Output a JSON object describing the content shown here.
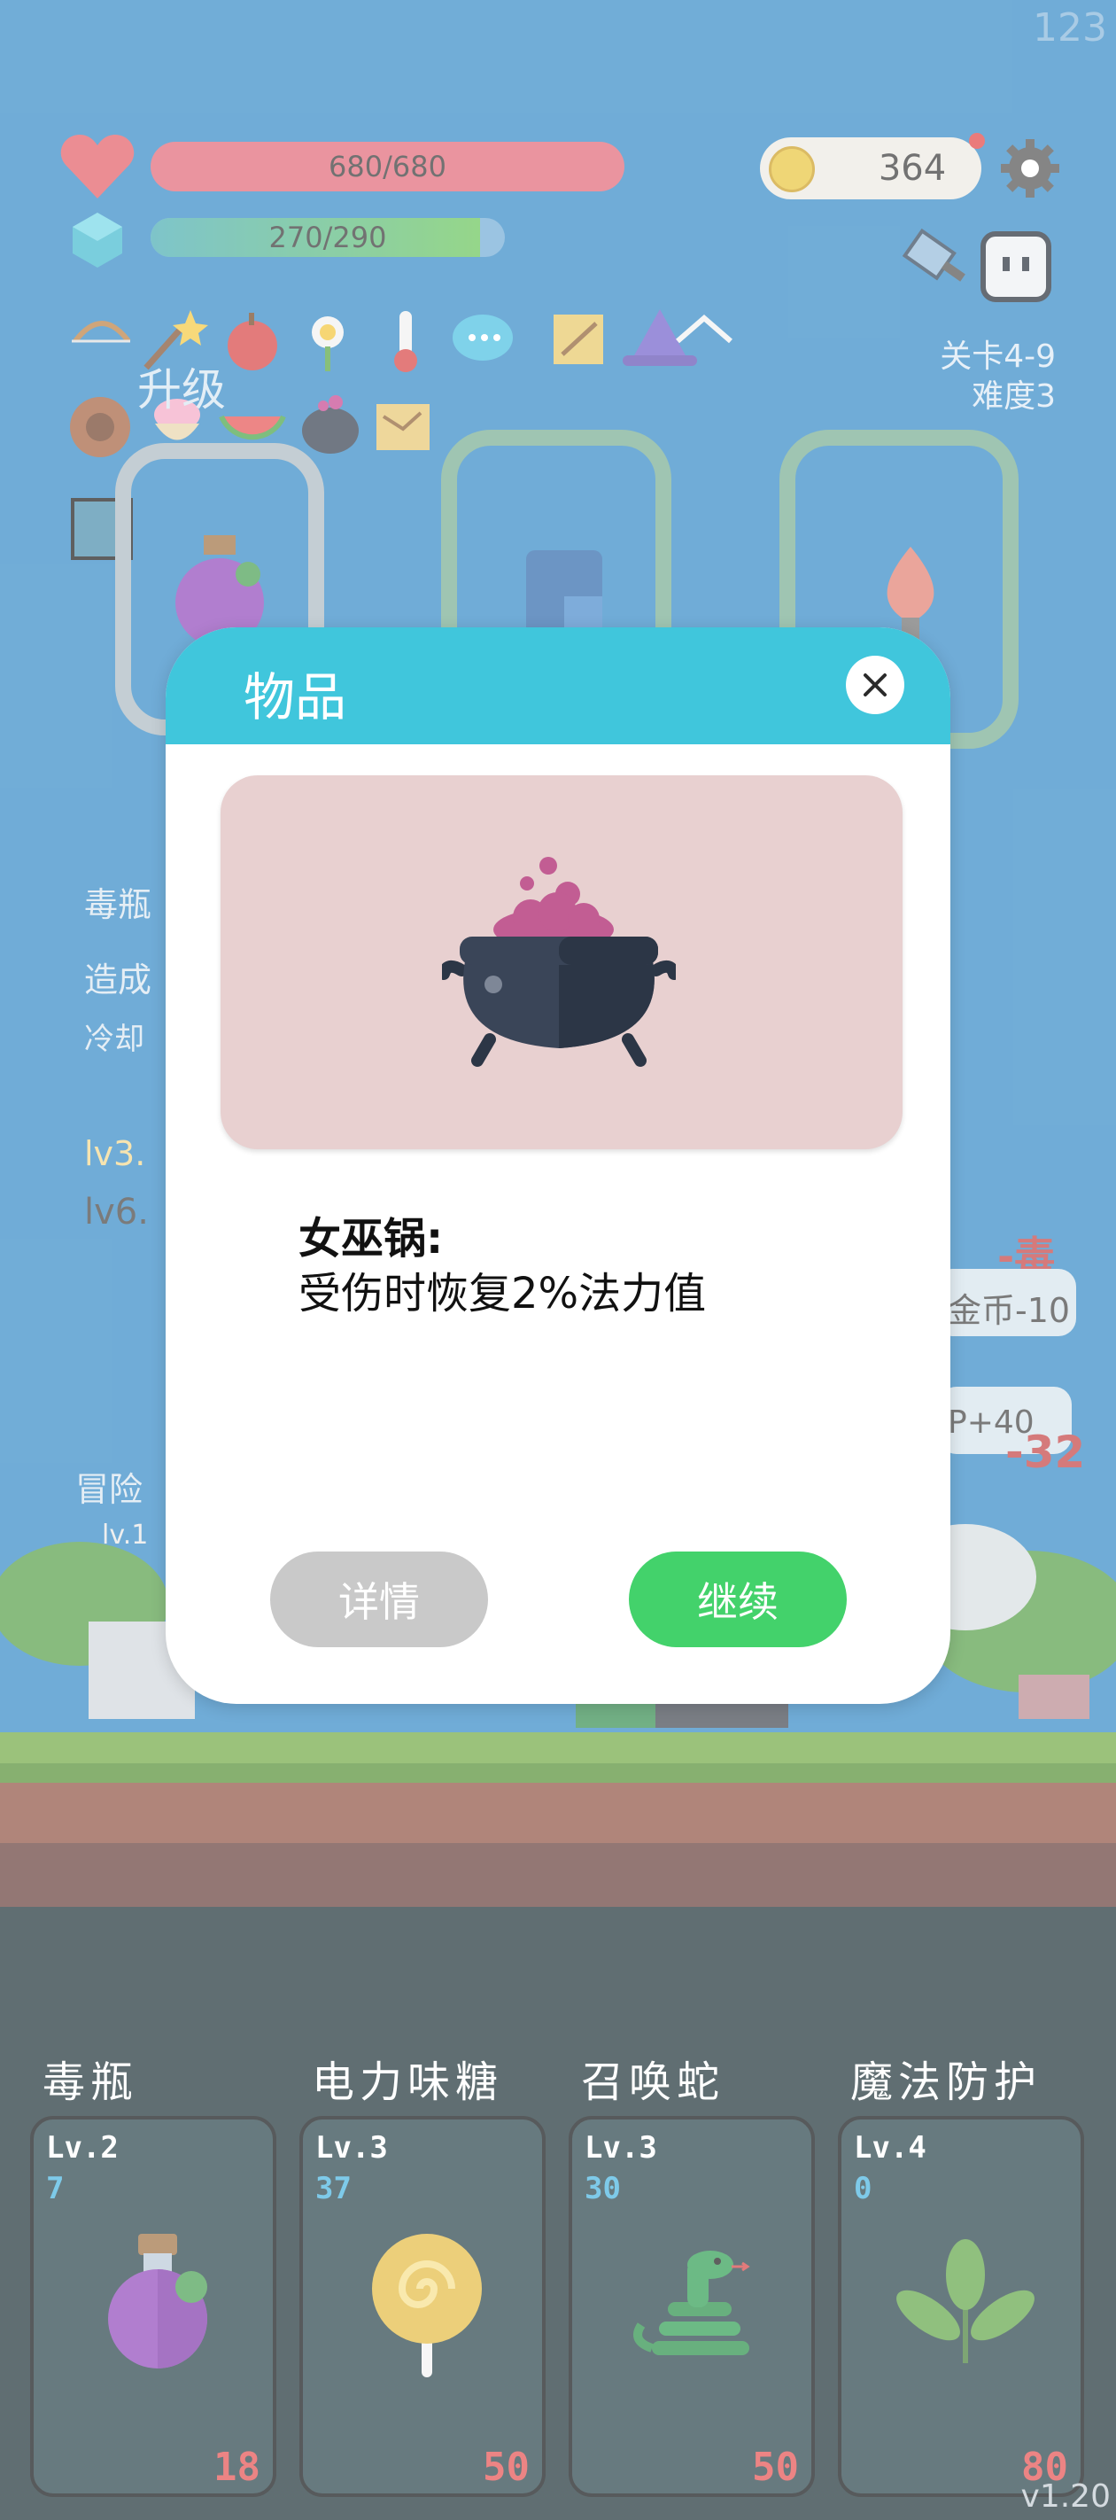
{
  "corner_number": "123",
  "hud": {
    "hp_text": "680/680",
    "hp_fraction": 1.0,
    "mp_text": "270/290",
    "mp_fraction": 0.931,
    "coins": "364",
    "stage": "关卡4-9",
    "difficulty": "难度3"
  },
  "upgrade_label": "升级",
  "background_texts": {
    "skill_name": "毒瓶",
    "skill_desc": "造成",
    "cooldown": "冷却",
    "lv3": "lv3.",
    "lv6": "lv6.",
    "adventure": "冒险",
    "hero_level": "lv.1",
    "coin_float": "金币-10",
    "mp_float": "P+40",
    "poison_float": "-毒",
    "damage_float": "-32"
  },
  "modal": {
    "title": "物品",
    "item_name": "女巫锅:",
    "item_desc": "受伤时恢复2%法力值",
    "detail_button": "详情",
    "continue_button": "继续"
  },
  "cards": [
    {
      "title": "毒瓶",
      "level": "Lv.2",
      "count": "7",
      "cost": "18",
      "icon": "poison-bottle-icon"
    },
    {
      "title": "电力味糖",
      "level": "Lv.3",
      "count": "37",
      "cost": "50",
      "icon": "lollipop-icon"
    },
    {
      "title": "召唤蛇",
      "level": "Lv.3",
      "count": "30",
      "cost": "50",
      "icon": "snake-icon"
    },
    {
      "title": "魔法防护",
      "level": "Lv.4",
      "count": "0",
      "cost": "80",
      "icon": "leaf-shield-icon"
    }
  ],
  "version": "v1.20",
  "colors": {
    "background": "#2b84c3",
    "modal_header": "#40c6dc",
    "continue_button": "#43d26b",
    "detail_button": "#c9c9c9",
    "hp_bar": "#e06070",
    "mp_bar": "#4cbe5a",
    "card_cost": "#e34848",
    "card_count": "#3fb1df"
  }
}
